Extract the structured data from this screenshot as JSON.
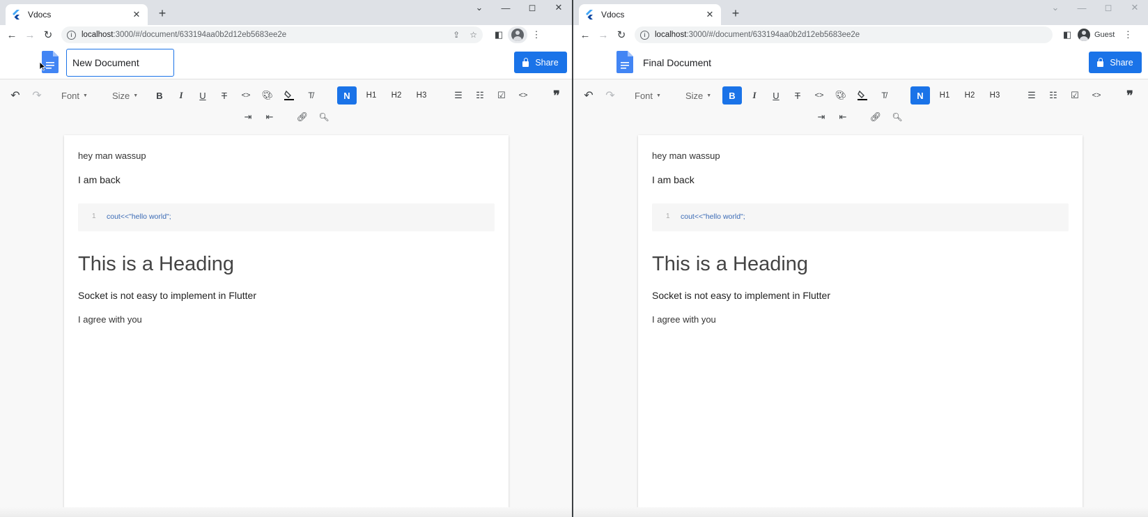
{
  "left_window": {
    "tab_title": "Vdocs",
    "url_host": "localhost",
    "url_path": ":3000/#/document/633194aa0b2d12eb5683ee2e",
    "doc_title": "New Document",
    "share_label": "Share"
  },
  "right_window": {
    "tab_title": "Vdocs",
    "url_host": "localhost",
    "url_path": ":3000/#/document/633194aa0b2d12eb5683ee2e",
    "profile_label": "Guest",
    "doc_title": "Final Document",
    "share_label": "Share"
  },
  "toolbar": {
    "font_label": "Font",
    "size_label": "Size",
    "normal_label": "N",
    "h1_label": "H1",
    "h2_label": "H2",
    "h3_label": "H3"
  },
  "document": {
    "line1": "hey man wassup",
    "line2": "I am back",
    "code_line_number": "1",
    "code_text": "cout<<\"hello world\";",
    "heading": "This is a Heading",
    "line3": "Socket is not easy to implement in Flutter",
    "line4": "I agree with you"
  },
  "colors": {
    "accent": "#1a73e8",
    "code_text": "#3a6ab5"
  },
  "icons": {
    "undo": "undo-icon",
    "redo": "redo-icon",
    "bold": "bold-icon",
    "italic": "italic-icon",
    "underline": "underline-icon",
    "strike": "strikethrough-icon",
    "inline_code": "inline-code-icon",
    "text_color": "palette-icon",
    "background_color": "fill-color-icon",
    "clear_format": "clear-format-icon",
    "ordered_list": "ordered-list-icon",
    "bullet_list": "bullet-list-icon",
    "checkbox": "checkbox-icon",
    "code_block": "code-block-icon",
    "quote": "quote-icon",
    "indent": "indent-icon",
    "outdent": "outdent-icon",
    "link": "link-icon",
    "search": "search-icon"
  }
}
